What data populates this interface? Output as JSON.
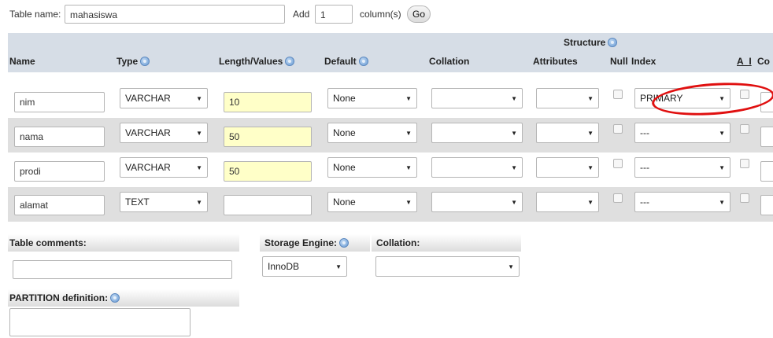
{
  "top": {
    "table_name_label": "Table name:",
    "table_name_value": "mahasiswa",
    "add_label": "Add",
    "add_count": "1",
    "columns_label": "column(s)",
    "go_label": "Go"
  },
  "structure_title": "Structure",
  "columns_header": {
    "name": "Name",
    "type": "Type",
    "length": "Length/Values",
    "default": "Default",
    "collation": "Collation",
    "attributes": "Attributes",
    "null": "Null",
    "index": "Index",
    "ai": "A_I",
    "comments": "Co"
  },
  "rows": [
    {
      "name": "nim",
      "type": "VARCHAR",
      "length": "10",
      "default": "None",
      "collation": "",
      "attributes": "",
      "index": "PRIMARY"
    },
    {
      "name": "nama",
      "type": "VARCHAR",
      "length": "50",
      "default": "None",
      "collation": "",
      "attributes": "",
      "index": "---"
    },
    {
      "name": "prodi",
      "type": "VARCHAR",
      "length": "50",
      "default": "None",
      "collation": "",
      "attributes": "",
      "index": "---"
    },
    {
      "name": "alamat",
      "type": "TEXT",
      "length": "",
      "default": "None",
      "collation": "",
      "attributes": "",
      "index": "---"
    }
  ],
  "bottom": {
    "table_comments_label": "Table comments:",
    "table_comments_value": "",
    "storage_engine_label": "Storage Engine:",
    "storage_engine_value": "InnoDB",
    "collation_label": "Collation:",
    "collation_value": "",
    "partition_label": "PARTITION definition:",
    "partition_value": ""
  },
  "colors": {
    "header_band": "#d6dde6",
    "row_alt": "#dfdfdf",
    "length_highlight": "#ffffc8",
    "annotation": "#e01010"
  },
  "icons": [
    "help-icon",
    "dropdown-arrow-icon"
  ]
}
